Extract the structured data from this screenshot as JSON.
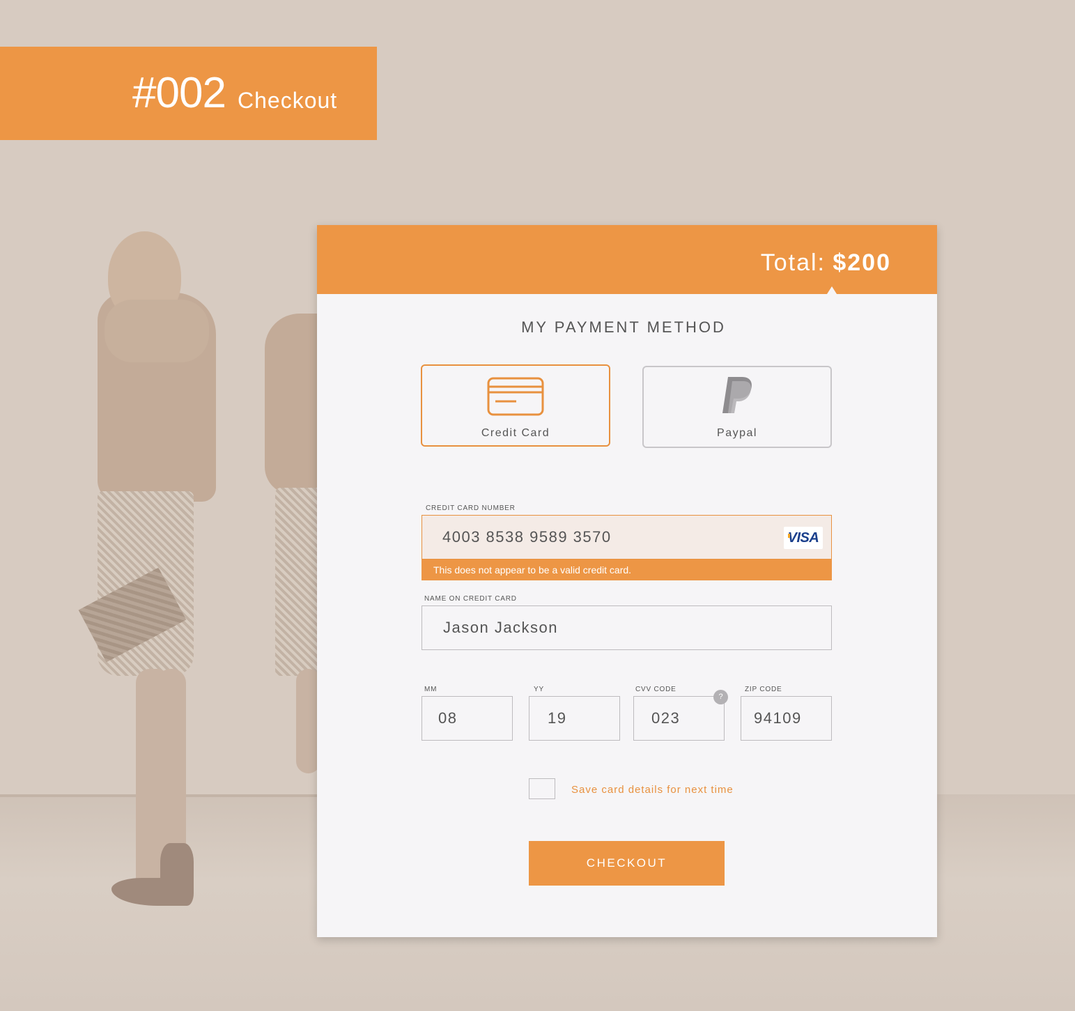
{
  "banner": {
    "number": "#002",
    "title": "Checkout"
  },
  "header": {
    "total_label": "Total:",
    "total_amount": "$200"
  },
  "section_title": "MY PAYMENT METHOD",
  "payment_methods": [
    {
      "label": "Credit Card",
      "icon": "credit-card-icon",
      "selected": true
    },
    {
      "label": "Paypal",
      "icon": "paypal-icon",
      "selected": false
    }
  ],
  "card_number": {
    "label": "CREDIT CARD NUMBER",
    "value": "4003 8538 9589 3570",
    "brand": "VISA",
    "error": "This does not appear to be a valid credit card."
  },
  "name": {
    "label": "NAME ON CREDIT CARD",
    "value": "Jason Jackson"
  },
  "expiry_month": {
    "label": "MM",
    "value": "08"
  },
  "expiry_year": {
    "label": "YY",
    "value": "19"
  },
  "cvv": {
    "label": "CVV CODE",
    "value": "023",
    "help": "?"
  },
  "zip": {
    "label": "ZIP CODE",
    "value": "94109"
  },
  "save_card": {
    "label": "Save card details for next time",
    "checked": false
  },
  "checkout_button": "CHECKOUT",
  "colors": {
    "accent": "#ed9645",
    "background": "#d7cbc1",
    "card": "#f6f5f7",
    "error_bg": "#f4ebe6"
  }
}
